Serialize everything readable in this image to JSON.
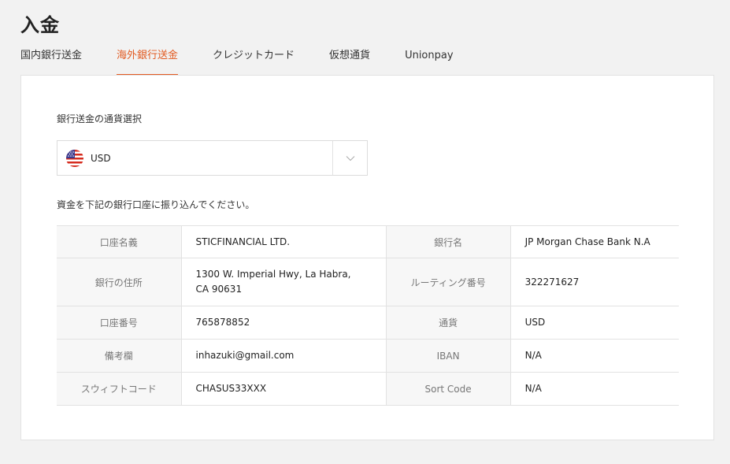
{
  "header": {
    "title": "入金"
  },
  "tabs": [
    {
      "label": "国内銀行送金",
      "active": false
    },
    {
      "label": "海外銀行送金",
      "active": true
    },
    {
      "label": "クレジットカード",
      "active": false
    },
    {
      "label": "仮想通貨",
      "active": false
    },
    {
      "label": "Unionpay",
      "active": false
    }
  ],
  "currency_select": {
    "label": "銀行送金の通貨選択",
    "value": "USD",
    "flag_icon": "us-flag-icon"
  },
  "instruction": "資金を下記の銀行口座に振り込んでください。",
  "bank_info": {
    "account_name_label": "口座名義",
    "account_name": "STICFINANCIAL LTD.",
    "bank_name_label": "銀行名",
    "bank_name": "JP Morgan Chase Bank N.A",
    "bank_address_label": "銀行の住所",
    "bank_address_line1": "1300 W. Imperial Hwy, La Habra,",
    "bank_address_line2": "CA 90631",
    "routing_label": "ルーティング番号",
    "routing_number": "322271627",
    "account_number_label": "口座番号",
    "account_number": "765878852",
    "currency_label": "通貨",
    "currency": "USD",
    "remarks_label": "備考欄",
    "remarks": "inhazuki@gmail.com",
    "iban_label": "IBAN",
    "iban": "N/A",
    "swift_label": "スウィフトコード",
    "swift": "CHASUS33XXX",
    "sort_code_label": "Sort Code",
    "sort_code": "N/A"
  },
  "colors": {
    "accent": "#e25a21",
    "background": "#f2f2f2"
  }
}
